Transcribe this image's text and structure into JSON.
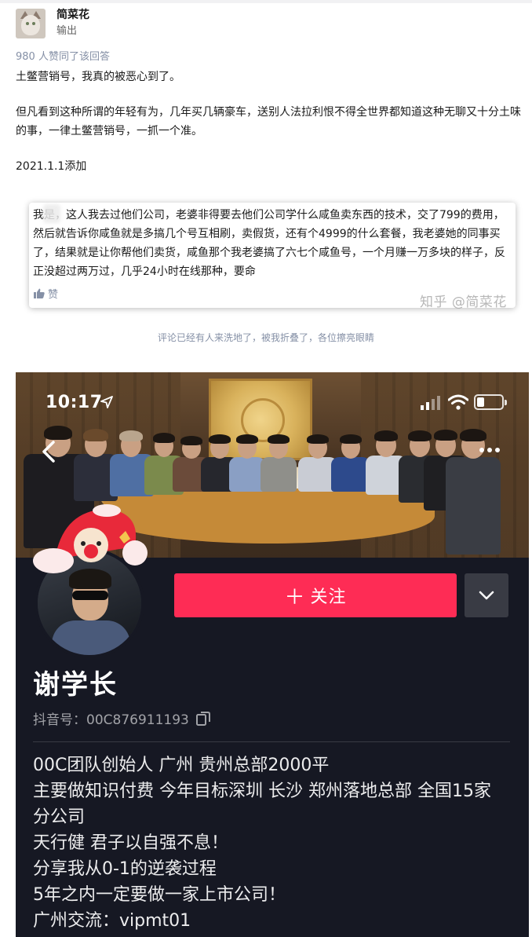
{
  "author": {
    "name": "简菜花",
    "bio": "输出"
  },
  "answer": {
    "votes": "980 人赞同了该回答",
    "paragraphs": [
      "土鳖营销号，我真的被恶心到了。",
      "但凡看到这种所谓的年轻有为，几年买几辆豪车，送别人法拉利恨不得全世界都知道这种无聊又十分土味的事，一律土鳖营销号，一抓一个准。",
      "2021.1.1添加"
    ]
  },
  "comment": {
    "text": "我是，这人我去过他们公司，老婆非得要去他们公司学什么咸鱼卖东西的技术，交了799的费用，然后就告诉你咸鱼就是多搞几个号互相刷，卖假货，还有个4999的什么套餐，我老婆她的同事买了，结果就是让你帮他们卖货，咸鱼那个我老婆搞了六七个咸鱼号，一个月赚一万多块的样子，反正没超过两万过，几乎24小时在线那种，要命",
    "like_label": "赞",
    "watermark": "知乎 @简菜花"
  },
  "caption": "评论已经有人来洗地了，被我折叠了，各位擦亮眼睛",
  "douyin": {
    "status_time": "10:17",
    "follow_label": "关注",
    "nickname": "谢学长",
    "douyin_id": "抖音号：00C876911193",
    "bio_lines": [
      "00C团队创始人 广州 贵州总部2000平",
      "主要做知识付费 今年目标深圳 长沙 郑州落地总部 全国15家",
      "分公司",
      "天行健 君子以自强不息！",
      "分享我从0-1的逆袭过程",
      "5年之内一定要做一家上市公司！",
      "广州交流：vipmt01"
    ],
    "colors": {
      "background": "#161823",
      "follow_button": "#fe2c55",
      "dropdown_button": "#393b44"
    }
  }
}
